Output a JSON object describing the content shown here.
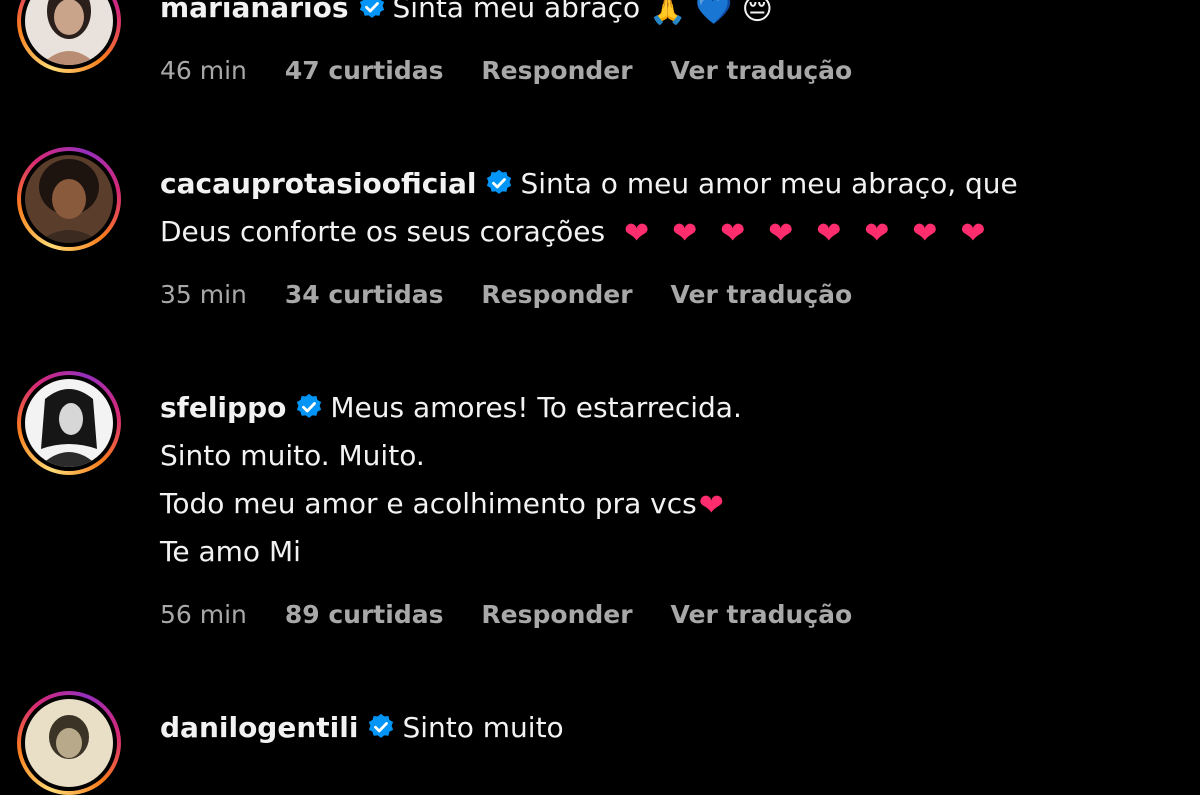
{
  "comments": [
    {
      "username": "marianarios",
      "text_lines": [
        "Sinta meu abraço"
      ],
      "emojis": [
        "🙏",
        "💙",
        "😔"
      ],
      "time": "46 min",
      "likes": "47 curtidas",
      "reply": "Responder",
      "translate": "Ver tradução"
    },
    {
      "username": "cacauprotasiooficial",
      "text_lines": [
        "Sinta o meu amor meu abraço, que",
        "Deus conforte os seus corações"
      ],
      "hearts": [
        "❤",
        "❤",
        "❤",
        "❤",
        "❤",
        "❤",
        "❤",
        "❤"
      ],
      "time": "35 min",
      "likes": "34 curtidas",
      "reply": "Responder",
      "translate": "Ver tradução"
    },
    {
      "username": "sfelippo",
      "text_lines": [
        "Meus amores! To estarrecida.",
        "Sinto muito. Muito.",
        "Todo meu amor e acolhimento pra vcs",
        "Te amo Mi"
      ],
      "heart": "❤",
      "time": "56 min",
      "likes": "89 curtidas",
      "reply": "Responder",
      "translate": "Ver tradução"
    },
    {
      "username": "danilogentili",
      "text_lines": [
        "Sinto muito"
      ]
    }
  ],
  "colors": {
    "background": "#000000",
    "text": "#f2f2f2",
    "meta": "#a8a8a8",
    "verified": "#0095f6",
    "heart": "#ff2d6d"
  },
  "icons": [
    "verified-badge-icon",
    "avatar-image"
  ]
}
